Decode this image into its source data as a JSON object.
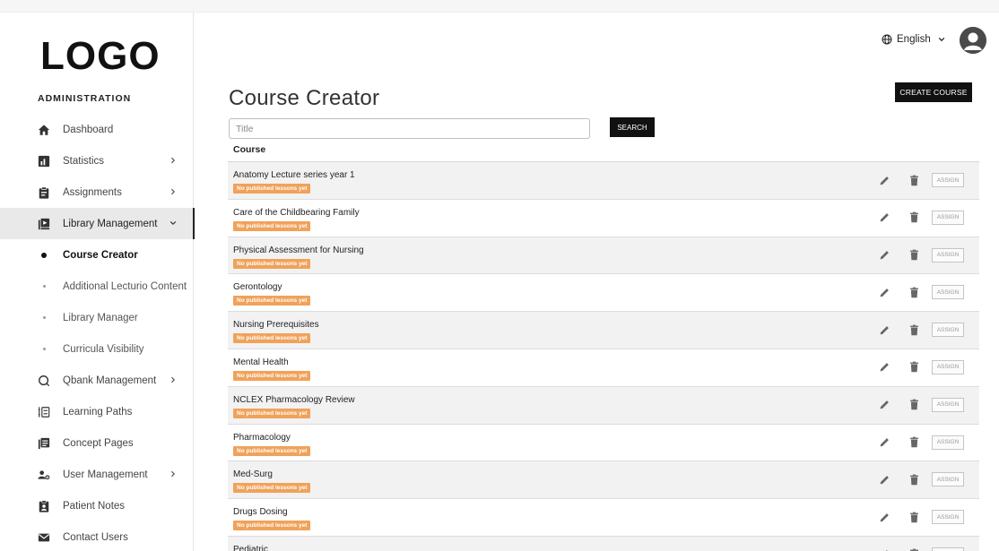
{
  "logo": "LOGO",
  "sidebar": {
    "heading": "ADMINISTRATION",
    "items": [
      {
        "label": "Dashboard",
        "icon": "home-icon",
        "chevron": "none"
      },
      {
        "label": "Statistics",
        "icon": "bar-chart-icon",
        "chevron": "right"
      },
      {
        "label": "Assignments",
        "icon": "clipboard-icon",
        "chevron": "right"
      },
      {
        "label": "Library Management",
        "icon": "library-icon",
        "chevron": "down",
        "active": true
      }
    ],
    "sub_items": [
      {
        "label": "Course Creator",
        "current": true
      },
      {
        "label": "Additional Lecturio Content"
      },
      {
        "label": "Library Manager"
      },
      {
        "label": "Curricula Visibility"
      }
    ],
    "items_after": [
      {
        "label": "Qbank Management",
        "icon": "qbank-icon",
        "chevron": "right"
      },
      {
        "label": "Learning Paths",
        "icon": "learning-paths-icon",
        "chevron": "none"
      },
      {
        "label": "Concept Pages",
        "icon": "concept-pages-icon",
        "chevron": "none"
      },
      {
        "label": "User Management",
        "icon": "user-management-icon",
        "chevron": "right"
      },
      {
        "label": "Patient Notes",
        "icon": "patient-notes-icon",
        "chevron": "none"
      },
      {
        "label": "Contact Users",
        "icon": "mail-icon",
        "chevron": "none"
      }
    ]
  },
  "header": {
    "language": "English",
    "language_icon": "globe-icon",
    "avatar_icon": "user-avatar-icon"
  },
  "main": {
    "title": "Course Creator",
    "create_label": "CREATE COURSE",
    "search_placeholder": "Title",
    "search_label": "SEARCH",
    "column_header": "Course",
    "badge_text": "No published lessons yet",
    "assign_label": "ASSIGN",
    "courses": [
      "Anatomy Lecture series year 1",
      "Care of the Childbearing Family",
      "Physical Assessment for Nursing",
      "Gerontology",
      "Nursing Prerequisites",
      "Mental Health",
      "NCLEX Pharmacology Review",
      "Pharmacology",
      "Med-Surg",
      "Drugs Dosing",
      "Pediatric"
    ]
  },
  "colors": {
    "badge": "#f0a25a",
    "button": "#111111",
    "active_nav": "#e9e9e9",
    "row_shade": "#f2f2f2"
  }
}
